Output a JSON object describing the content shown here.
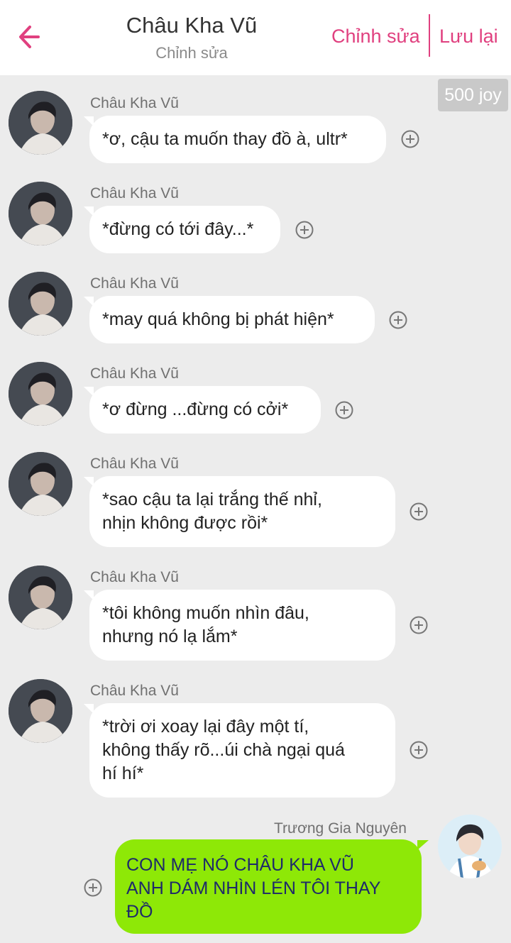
{
  "header": {
    "title": "Châu Kha Vũ",
    "subtitle": "Chỉnh sửa",
    "edit_label": "Chỉnh sửa",
    "save_label": "Lưu lại",
    "accent_color": "#e0407f",
    "back_icon": "arrow-left-icon"
  },
  "joy_badge": "500 joy",
  "messages": [
    {
      "sender": "Châu Kha Vũ",
      "text": "*ơ, cậu ta muốn thay đồ à, ultr*"
    },
    {
      "sender": "Châu Kha Vũ",
      "text": "*đừng có tới đây...*"
    },
    {
      "sender": "Châu Kha Vũ",
      "text": "*may quá không bị phát hiện*"
    },
    {
      "sender": "Châu Kha Vũ",
      "text": "*ơ đừng ...đừng có cởi*"
    },
    {
      "sender": "Châu Kha Vũ",
      "text": "*sao cậu ta lại trắng thế nhỉ,\nnhịn không được rồi*"
    },
    {
      "sender": "Châu Kha Vũ",
      "text": "*tôi không muốn nhìn đâu,\nnhưng nó lạ lắm*"
    },
    {
      "sender": "Châu Kha Vũ",
      "text": "*trời ơi xoay lại đây một tí,\nkhông thấy rõ...úi chà ngại quá\nhí hí*"
    }
  ],
  "reply": {
    "sender": "Trương Gia Nguyên",
    "text": "CON MẸ NÓ CHÂU KHA VŨ\nANH DÁM NHÌN LÉN TÔI THAY\nĐỒ",
    "bubble_color": "#8ee807"
  },
  "icons": {
    "add": "plus-circle-icon"
  }
}
